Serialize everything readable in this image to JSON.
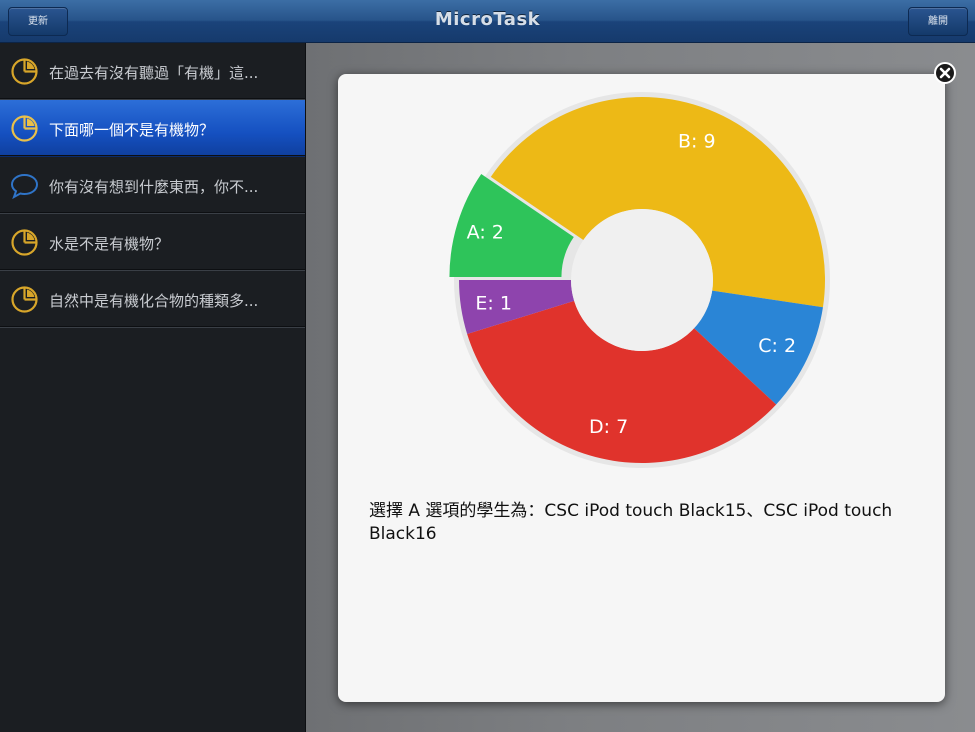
{
  "header": {
    "title": "MicroTask",
    "refresh_label": "更新",
    "logout_label": "離開"
  },
  "sidebar": {
    "items": [
      {
        "label": "在過去有沒有聽過「有機」這...",
        "icon": "pie-chart-icon",
        "selected": false
      },
      {
        "label": "下面哪一個不是有機物？",
        "icon": "pie-chart-icon",
        "selected": true
      },
      {
        "label": "你有沒有想到什麼東西，你不...",
        "icon": "speech-bubble-icon",
        "selected": false
      },
      {
        "label": "水是不是有機物？",
        "icon": "pie-chart-icon",
        "selected": false
      },
      {
        "label": "自然中是有機化合物的種類多...",
        "icon": "pie-chart-icon",
        "selected": false
      }
    ]
  },
  "colors": {
    "accent": "#1550c0",
    "icon_gold": "#d8a62a",
    "icon_blue": "#2f74c8"
  },
  "modal": {
    "close_icon": "close-icon",
    "result_text": "選擇 A 選項的學生為：CSC iPod touch Black15、CSC iPod touch Black16"
  },
  "chart_data": {
    "type": "pie",
    "donut": true,
    "start_angle_deg": 180,
    "exploded": "A",
    "slices": [
      {
        "label": "A",
        "value": 2,
        "color": "#2ec45a"
      },
      {
        "label": "B",
        "value": 9,
        "color": "#edb916"
      },
      {
        "label": "C",
        "value": 2,
        "color": "#2a85d6"
      },
      {
        "label": "D",
        "value": 7,
        "color": "#e0332c"
      },
      {
        "label": "E",
        "value": 1,
        "color": "#8e44ad"
      }
    ]
  }
}
